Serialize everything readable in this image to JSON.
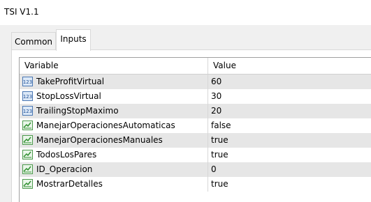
{
  "window": {
    "title": "TSI V1.1"
  },
  "tabs": [
    {
      "label": "Common",
      "active": false
    },
    {
      "label": "Inputs",
      "active": true
    }
  ],
  "grid": {
    "columns": [
      "Variable",
      "Value"
    ],
    "rows": [
      {
        "icon": "numeric-123-icon",
        "variable": "TakeProfitVirtual",
        "value": "60"
      },
      {
        "icon": "numeric-123-icon",
        "variable": "StopLossVirtual",
        "value": "30"
      },
      {
        "icon": "numeric-123-icon",
        "variable": "TrailingStopMaximo",
        "value": "20"
      },
      {
        "icon": "boolean-chart-icon",
        "variable": "ManejarOperacionesAutomaticas",
        "value": "false"
      },
      {
        "icon": "boolean-chart-icon",
        "variable": "ManejarOperacionesManuales",
        "value": "true"
      },
      {
        "icon": "boolean-chart-icon",
        "variable": "TodosLosPares",
        "value": "true"
      },
      {
        "icon": "boolean-chart-icon",
        "variable": "ID_Operacion",
        "value": "0"
      },
      {
        "icon": "boolean-chart-icon",
        "variable": "MostrarDetalles",
        "value": "true"
      }
    ]
  }
}
